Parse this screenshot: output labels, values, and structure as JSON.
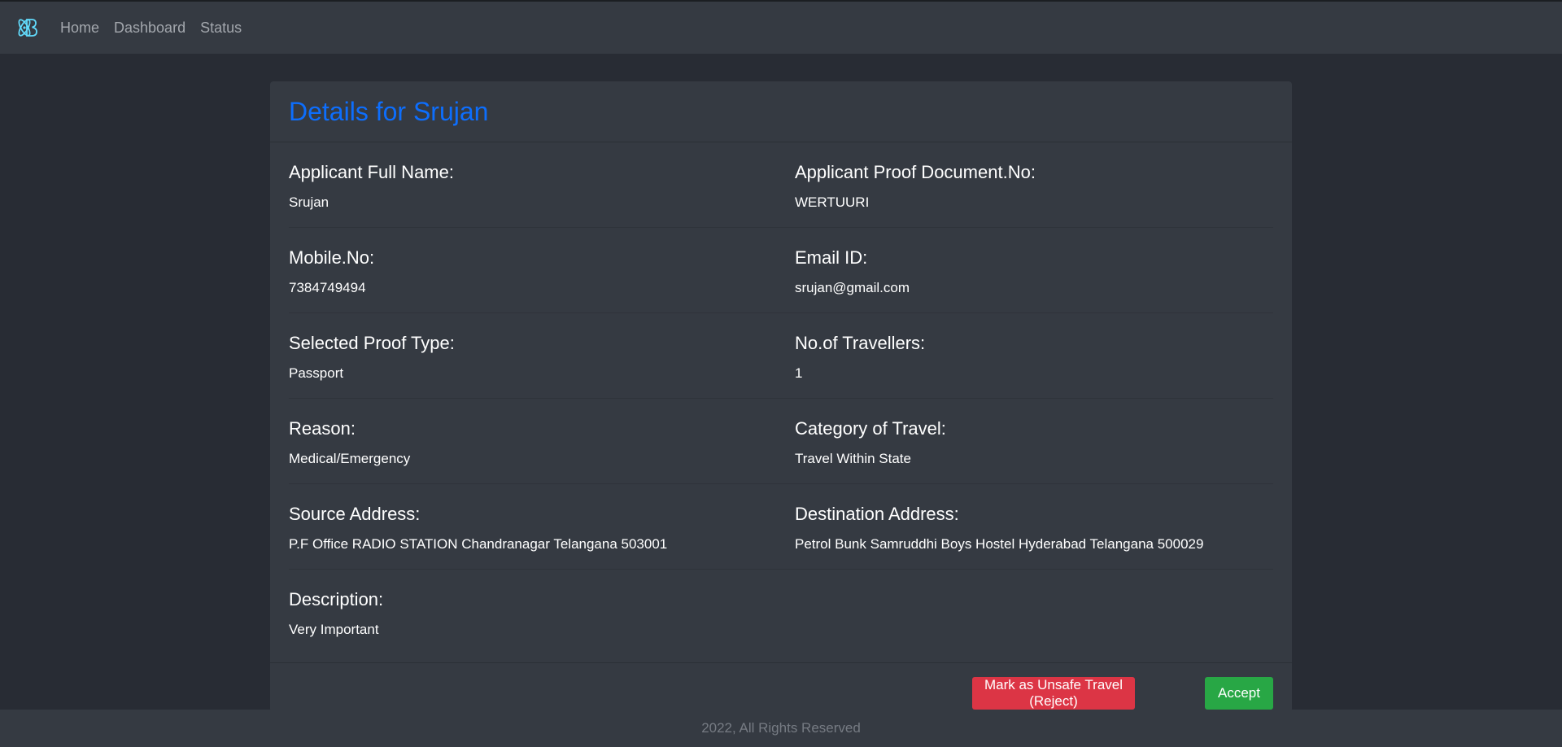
{
  "nav": {
    "brand_icon": "react-logo-icon",
    "links": [
      "Home",
      "Dashboard",
      "Status"
    ]
  },
  "card": {
    "title": "Details for Srujan",
    "rows": [
      {
        "left": {
          "label": "Applicant Full Name:",
          "value": "Srujan"
        },
        "right": {
          "label": "Applicant Proof Document.No:",
          "value": "WERTUURI"
        }
      },
      {
        "left": {
          "label": "Mobile.No:",
          "value": "7384749494"
        },
        "right": {
          "label": "Email ID:",
          "value": "srujan@gmail.com"
        }
      },
      {
        "left": {
          "label": "Selected Proof Type:",
          "value": "Passport"
        },
        "right": {
          "label": "No.of Travellers:",
          "value": "1"
        }
      },
      {
        "left": {
          "label": "Reason:",
          "value": "Medical/Emergency"
        },
        "right": {
          "label": "Category of Travel:",
          "value": "Travel Within State"
        }
      },
      {
        "left": {
          "label": "Source Address:",
          "value": "P.F Office RADIO STATION Chandranagar Telangana 503001"
        },
        "right": {
          "label": "Destination Address:",
          "value": "Petrol Bunk Samruddhi Boys Hostel Hyderabad Telangana 500029"
        }
      },
      {
        "left": {
          "label": "Description:",
          "value": "Very Important"
        }
      }
    ],
    "actions": {
      "reject_label": "Mark as Unsafe Travel (Reject)",
      "accept_label": "Accept"
    }
  },
  "footer": {
    "text": "2022, All Rights Reserved"
  },
  "colors": {
    "page_background": "#282c34",
    "surface": "#353a42",
    "title_blue": "#0d6efd",
    "reject_red": "#dc3545",
    "accept_green": "#28a745",
    "react_cyan": "#61dafb"
  }
}
